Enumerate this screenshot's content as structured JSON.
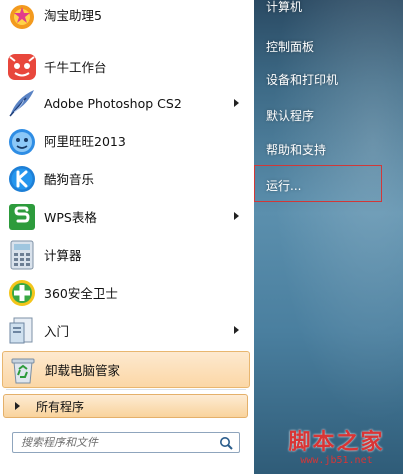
{
  "left_panel": {
    "programs": [
      {
        "label": "淘宝助理5",
        "icon": "taobao-assistant-icon",
        "has_arrow": false
      },
      {
        "label": "千牛工作台",
        "icon": "qianniu-icon",
        "has_arrow": false
      },
      {
        "label": "Adobe Photoshop CS2",
        "icon": "photoshop-feather-icon",
        "has_arrow": true
      },
      {
        "label": "阿里旺旺2013",
        "icon": "aliwangwang-icon",
        "has_arrow": false
      },
      {
        "label": "酷狗音乐",
        "icon": "kugou-music-icon",
        "has_arrow": false
      },
      {
        "label": "WPS表格",
        "icon": "wps-spreadsheet-icon",
        "has_arrow": true
      },
      {
        "label": "计算器",
        "icon": "calculator-icon",
        "has_arrow": false
      },
      {
        "label": "360安全卫士",
        "icon": "360-security-icon",
        "has_arrow": false
      },
      {
        "label": "入门",
        "icon": "getting-started-icon",
        "has_arrow": true
      },
      {
        "label": "卸载电脑管家",
        "icon": "recycle-bin-icon",
        "has_arrow": false,
        "selected": true
      }
    ],
    "all_programs_label": "所有程序",
    "search_placeholder": "搜索程序和文件"
  },
  "right_panel": {
    "items": [
      {
        "label": "计算机"
      },
      {
        "label": "控制面板"
      },
      {
        "label": "设备和打印机"
      },
      {
        "label": "默认程序"
      },
      {
        "label": "帮助和支持"
      },
      {
        "label": "运行..."
      }
    ]
  },
  "watermark": {
    "title": "脚本之家",
    "url": "www.jb51.net"
  },
  "colors": {
    "highlight_border": "#d13838",
    "selected_bg": "#fbd7a6",
    "watermark": "#d93535"
  }
}
